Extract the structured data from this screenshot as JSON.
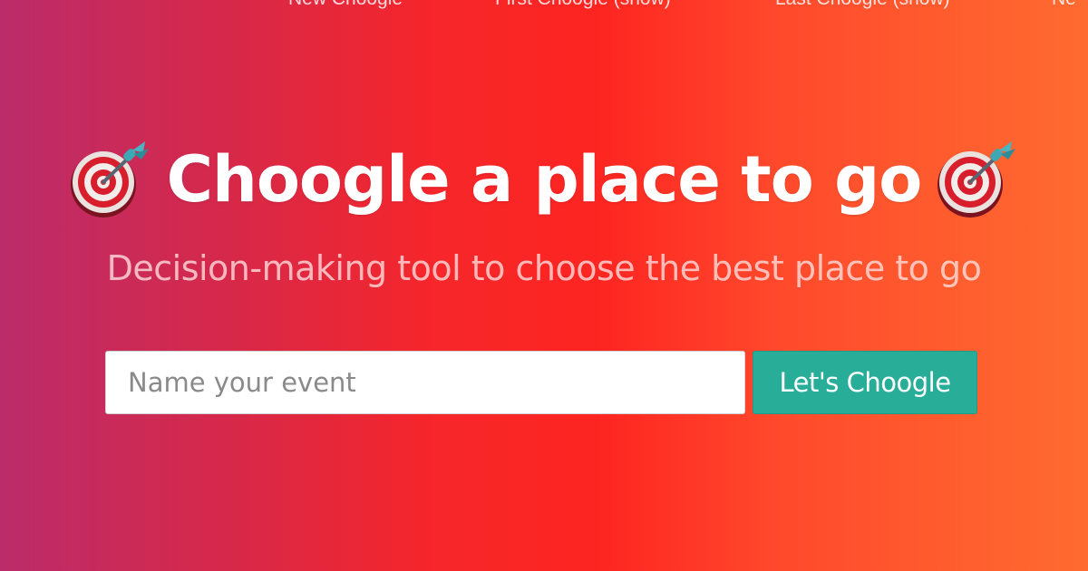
{
  "nav": {
    "links": [
      {
        "label": "New Choogle"
      },
      {
        "label": "First Choogle (show)"
      },
      {
        "label": "Last Choogle (show)"
      },
      {
        "label": "Ne"
      }
    ]
  },
  "hero": {
    "title": "Choogle a place to go",
    "subtitle": "Decision-making tool to choose the best place to go",
    "icon": "direct-hit-target-icon"
  },
  "form": {
    "input_placeholder": "Name your event",
    "input_value": "",
    "submit_label": "Let's Choogle"
  },
  "colors": {
    "gradient_left": "#bb2c6a",
    "gradient_mid": "#fd2521",
    "gradient_right": "#ff6b30",
    "button": "#27ad98",
    "text": "#ffffff"
  }
}
